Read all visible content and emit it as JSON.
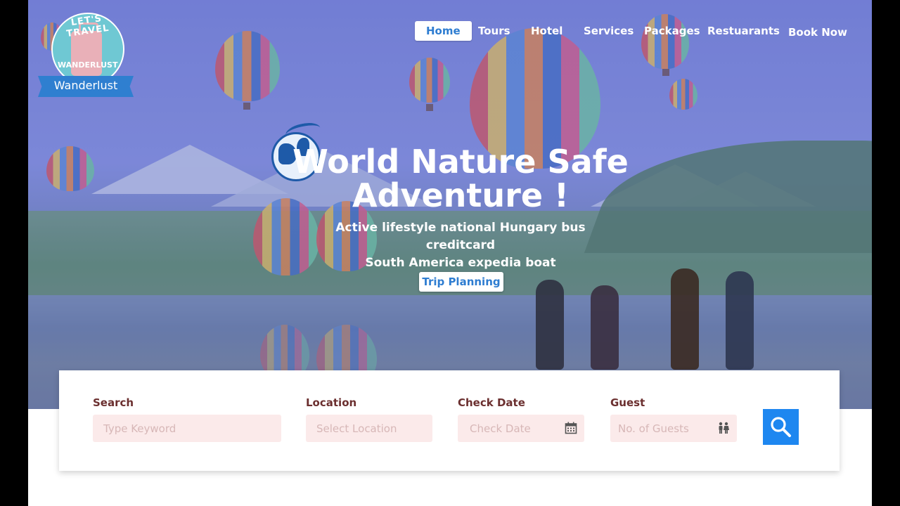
{
  "logo": {
    "arc_text": "LET'S TRAVEL",
    "badge_text": "WANDERLUST",
    "ribbon_text": "Wanderlust"
  },
  "nav": {
    "items": [
      {
        "label": "Home",
        "active": true
      },
      {
        "label": "Tours",
        "active": false
      },
      {
        "label": "Hotel",
        "active": false
      },
      {
        "label": "Services",
        "active": false
      },
      {
        "label": "Packages",
        "active": false
      },
      {
        "label": "Restuarants",
        "active": false
      },
      {
        "label": "Book Now",
        "active": false
      }
    ]
  },
  "hero": {
    "title_line1": "World Nature Safe",
    "title_line2": "Adventure !",
    "subtitle_line1": "Active lifestyle national Hungary bus creditcard",
    "subtitle_line2": "South America expedia boat",
    "cta_label": "Trip Planning",
    "globe_icon": "globe-icon"
  },
  "search": {
    "fields": [
      {
        "label": "Search",
        "placeholder": "Type Keyword"
      },
      {
        "label": "Location",
        "placeholder": "Select Location"
      },
      {
        "label": "Check Date",
        "placeholder": "Check Date",
        "icon": "calendar-icon"
      },
      {
        "label": "Guest",
        "placeholder": "No. of Guests",
        "icon": "people-icon"
      }
    ],
    "button_icon": "search-icon"
  },
  "colors": {
    "accent": "#2e7dd1",
    "search_button": "#1e87f0",
    "label": "#6b2f2f",
    "input_bg": "#fbeaea"
  }
}
